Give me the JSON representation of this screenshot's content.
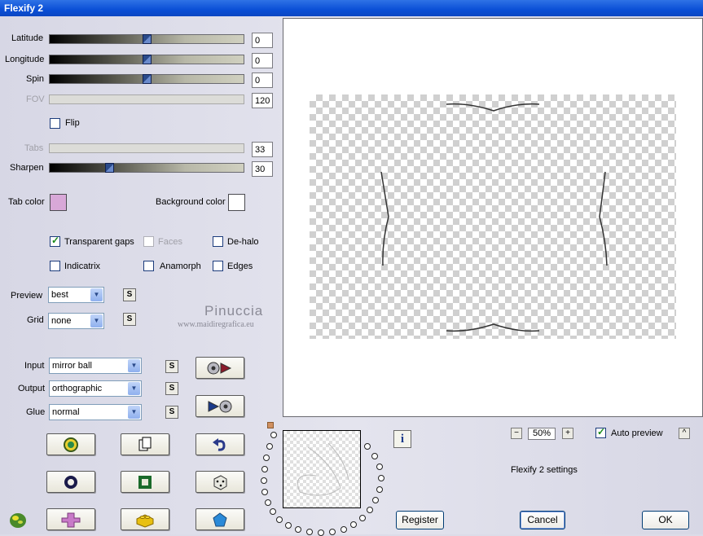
{
  "window": {
    "title": "Flexify 2"
  },
  "sliders": [
    {
      "label": "Latitude",
      "value": "0",
      "level": 0.5,
      "enabled": true
    },
    {
      "label": "Longitude",
      "value": "0",
      "level": 0.5,
      "enabled": true
    },
    {
      "label": "Spin",
      "value": "0",
      "level": 0.5,
      "enabled": true
    },
    {
      "label": "FOV",
      "value": "120",
      "level": 0.0,
      "enabled": false
    },
    {
      "label": "Tabs",
      "value": "33",
      "level": 0.0,
      "enabled": false
    },
    {
      "label": "Sharpen",
      "value": "30",
      "level": 0.3,
      "enabled": true
    }
  ],
  "flip": {
    "label": "Flip",
    "checked": false
  },
  "colors": {
    "tab_label": "Tab color",
    "tab_color": "#d8a8d8",
    "bg_label": "Background color",
    "bg_color": "#ffffff"
  },
  "options": {
    "transparent_gaps": {
      "label": "Transparent gaps",
      "checked": true
    },
    "faces": {
      "label": "Faces",
      "checked": false,
      "enabled": false
    },
    "de_halo": {
      "label": "De-halo",
      "checked": false
    },
    "indicatrix": {
      "label": "Indicatrix",
      "checked": false
    },
    "anamorph": {
      "label": "Anamorph",
      "checked": false
    },
    "edges": {
      "label": "Edges",
      "checked": false
    }
  },
  "preview": {
    "label": "Preview",
    "value": "best"
  },
  "grid": {
    "label": "Grid",
    "value": "none"
  },
  "s_label": "S",
  "watermark": {
    "name": "Pinuccia",
    "url": "www.maidiregrafica.eu"
  },
  "input": {
    "label": "Input",
    "value": "mirror ball"
  },
  "output": {
    "label": "Output",
    "value": "orthographic"
  },
  "glue": {
    "label": "Glue",
    "value": "normal"
  },
  "zoom": {
    "value": "50%",
    "minus": "−",
    "plus": "+"
  },
  "auto_preview": {
    "label": "Auto preview",
    "checked": true
  },
  "settings_text": "Flexify 2 settings",
  "buttons": {
    "register": "Register",
    "cancel": "Cancel",
    "ok": "OK"
  },
  "info_label": "i",
  "collapse_label": "^"
}
